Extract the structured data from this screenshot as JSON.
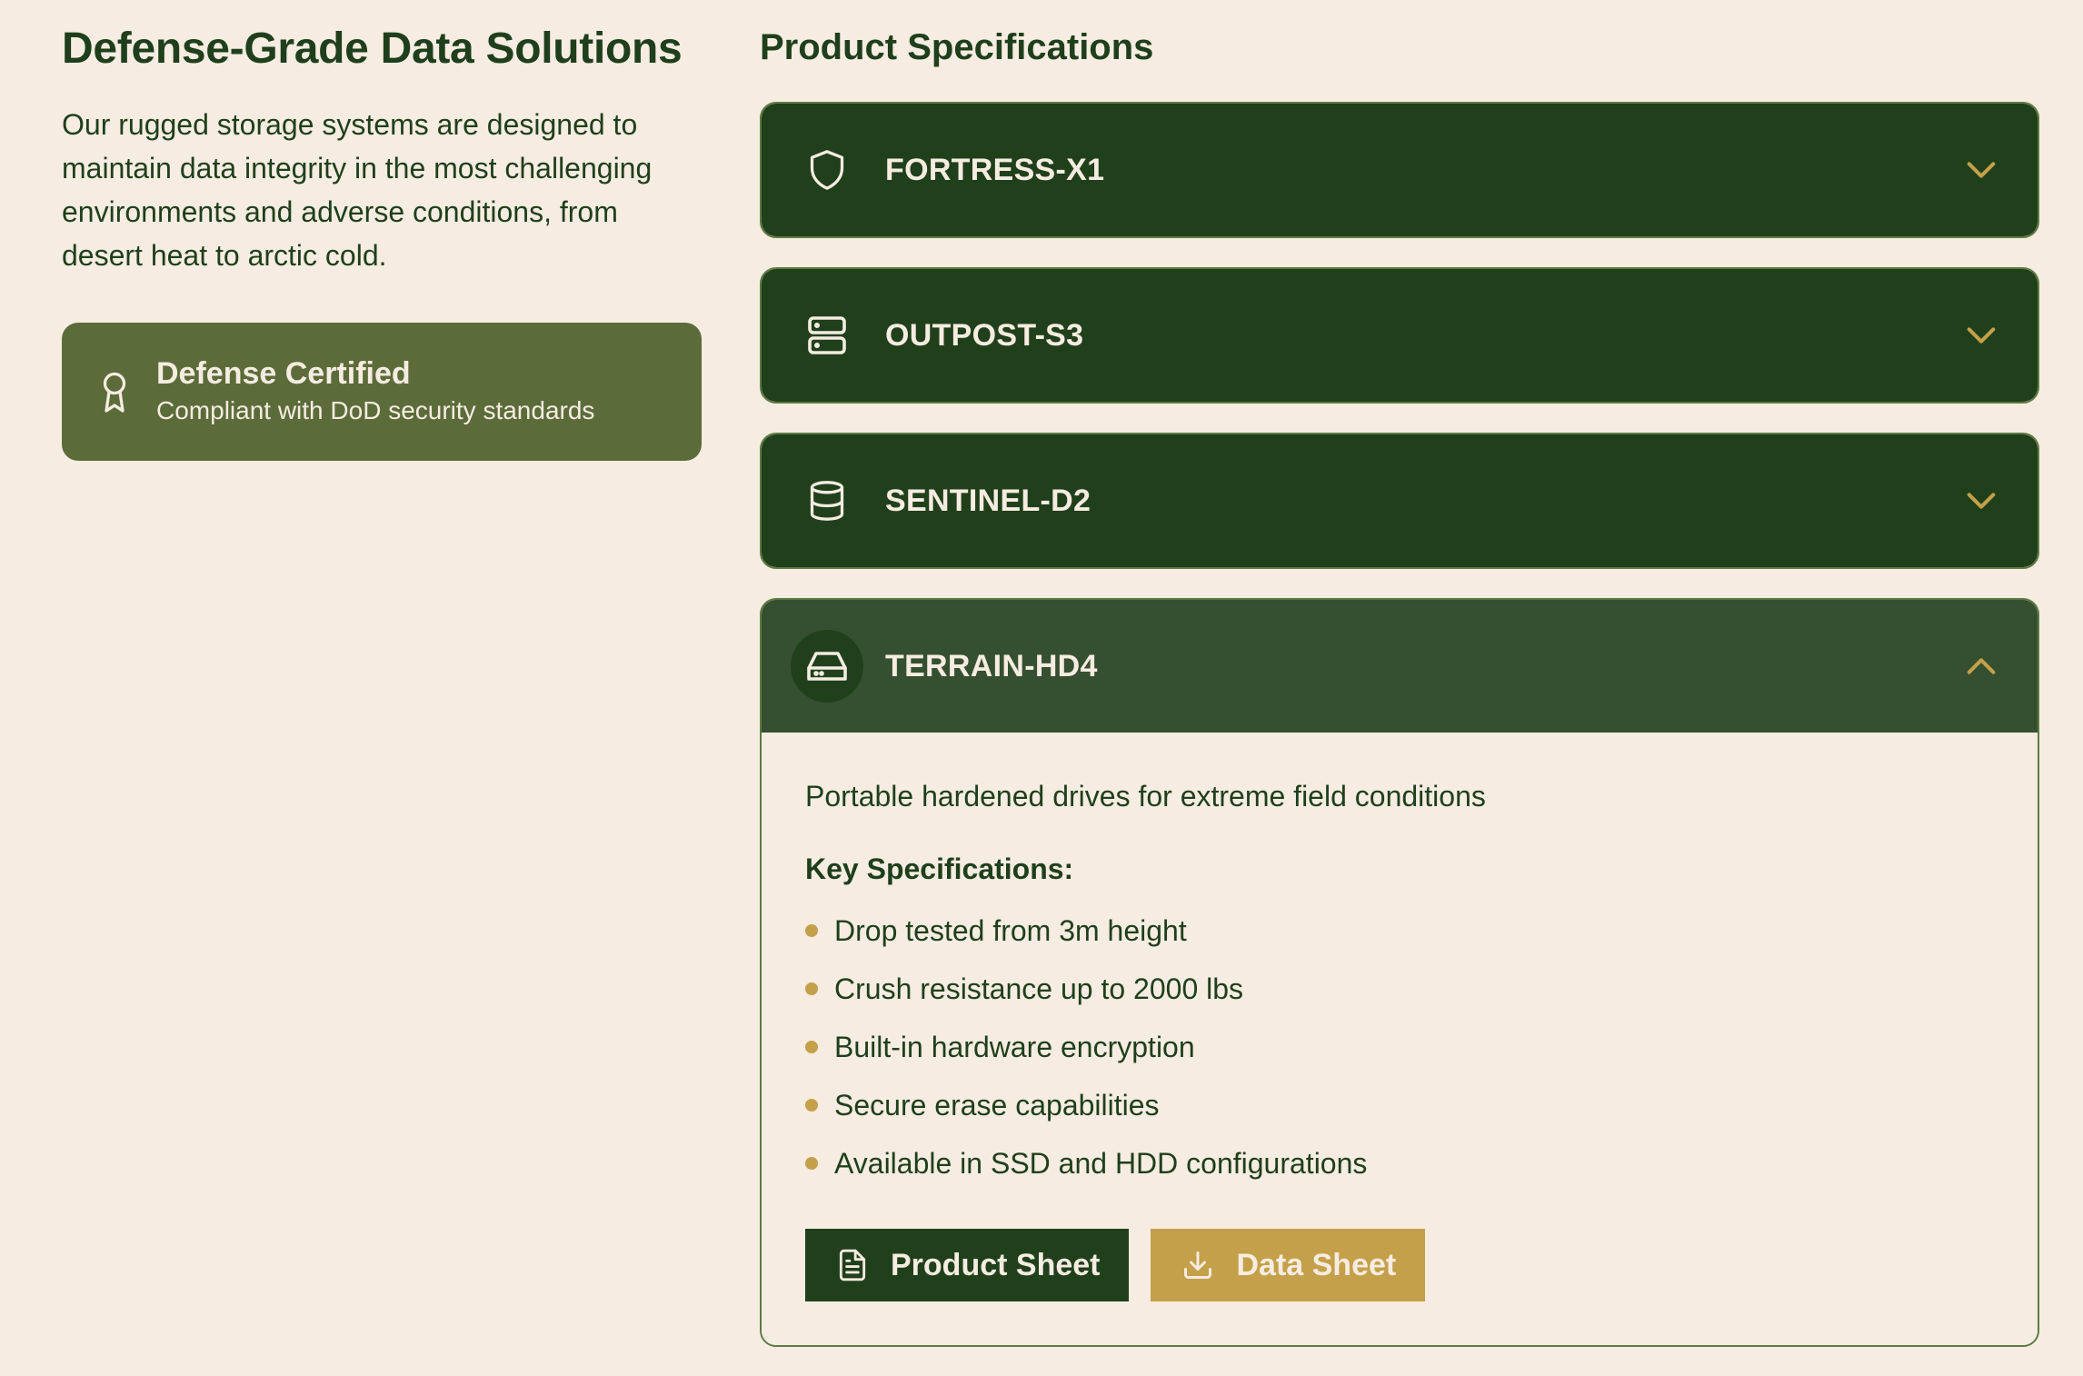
{
  "intro_panel": {
    "title": "Defense-Grade Data Solutions",
    "description": "Our rugged storage systems are designed to maintain data integrity in the most challenging environments and adverse conditions, from desert heat to arctic cold.",
    "certification": {
      "icon": "award-icon",
      "title": "Defense Certified",
      "subtitle": "Compliant with DoD security standards"
    }
  },
  "specs_panel": {
    "title": "Product Specifications",
    "products": [
      {
        "name": "FORTRESS-X1",
        "icon": "shield-icon",
        "expanded": false
      },
      {
        "name": "OUTPOST-S3",
        "icon": "server-icon",
        "expanded": false
      },
      {
        "name": "SENTINEL-D2",
        "icon": "database-icon",
        "expanded": false
      },
      {
        "name": "TERRAIN-HD4",
        "icon": "hard-drive-icon",
        "expanded": true,
        "description": "Portable hardened drives for extreme field conditions",
        "specs_heading": "Key Specifications:",
        "specs": [
          "Drop tested from 3m height",
          "Crush resistance up to 2000 lbs",
          "Built-in hardware encryption",
          "Secure erase capabilities",
          "Available in SSD and HDD configurations"
        ],
        "buttons": {
          "product_sheet": "Product Sheet",
          "data_sheet": "Data Sheet"
        }
      }
    ]
  },
  "colors": {
    "background": "#f6ece1",
    "dark_green": "#20401b",
    "open_header": "#355030",
    "olive": "#5b6c3a",
    "gold": "#c5a04a"
  }
}
